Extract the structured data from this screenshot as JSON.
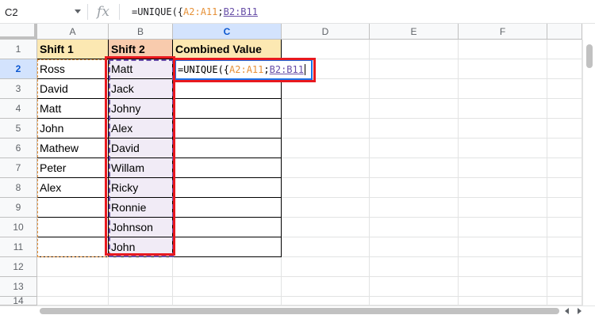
{
  "formula_bar": {
    "name_box": "C2",
    "fx_icon": "fx-icon",
    "formula_prefix": "=UNIQUE({",
    "formula_ref_a": "A2:A11",
    "formula_sep": ";",
    "formula_ref_b": "B2:B11"
  },
  "columns": [
    "A",
    "B",
    "C",
    "D",
    "E",
    "F"
  ],
  "rows": [
    "1",
    "2",
    "3",
    "4",
    "5",
    "6",
    "7",
    "8",
    "9",
    "10",
    "11",
    "12",
    "13",
    "14"
  ],
  "headers": {
    "a": "Shift 1",
    "b": "Shift 2",
    "c": "Combined  Value"
  },
  "shift1": [
    "Ross",
    "David",
    "Matt",
    "John",
    "Mathew",
    "Peter",
    "Alex",
    "",
    "",
    ""
  ],
  "shift2": [
    "Matt",
    "Jack",
    "Johny",
    "Alex",
    "David",
    "Willam",
    "Ricky",
    "Ronnie",
    "Johnson",
    "John"
  ],
  "editor": {
    "prefix": "=UNIQUE({",
    "ref_a": "A2:A11",
    "sep": ";",
    "ref_b": "B2:B11"
  },
  "colors": {
    "ref_a": "#e69138",
    "ref_b": "#674ea7",
    "highlight_box": "#e8191f",
    "header_a": "#fce8b2",
    "header_b": "#f8cbad"
  }
}
